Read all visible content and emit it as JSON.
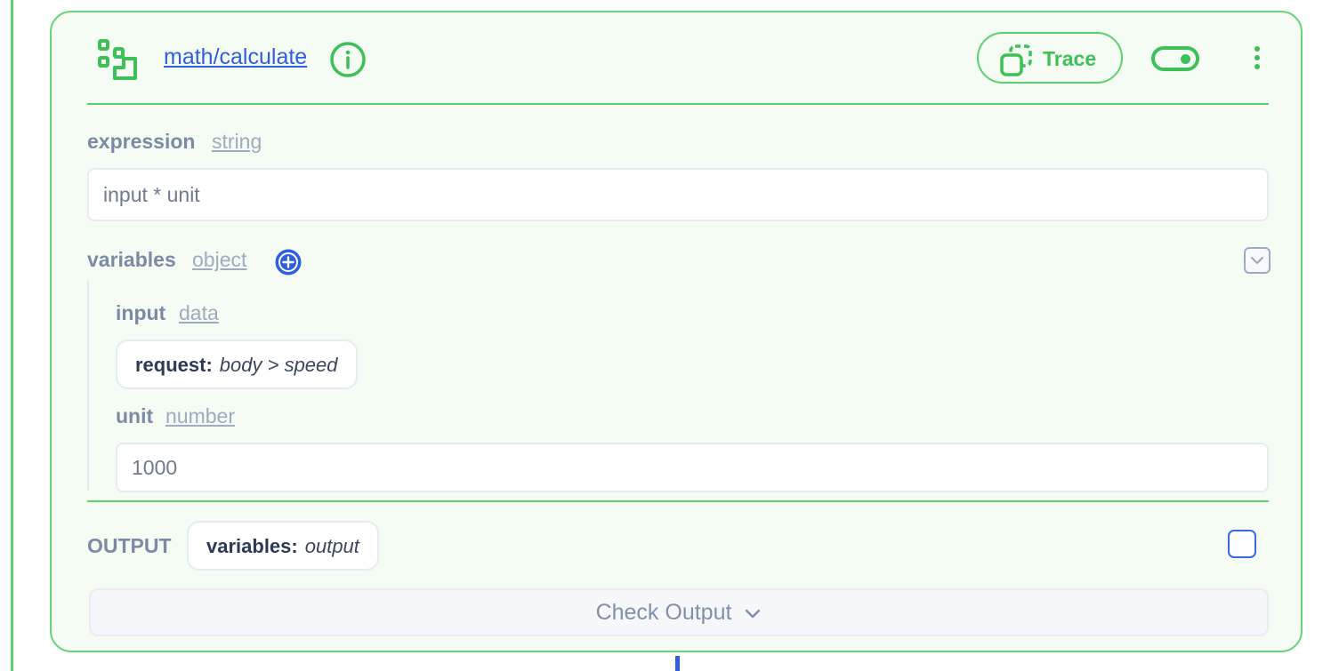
{
  "node": {
    "title": "math/calculate",
    "icon": "workflow-steps-icon",
    "info_icon": "info-circle-icon",
    "trace_label": "Trace",
    "trace_icon": "copy-dashed-icon",
    "enabled": true,
    "menu_icon": "vertical-dots-icon"
  },
  "fields": {
    "expression": {
      "label": "expression",
      "type": "string",
      "value": "input * unit"
    },
    "variables": {
      "label": "variables",
      "type": "object",
      "add_icon": "plus-circle-icon",
      "collapse_icon": "chevron-down-icon",
      "input": {
        "label": "input",
        "type": "data",
        "chip_key": "request:",
        "chip_value": "body > speed"
      },
      "unit": {
        "label": "unit",
        "type": "number",
        "value": "1000"
      }
    }
  },
  "output": {
    "label": "OUTPUT",
    "chip_key": "variables:",
    "chip_value": "output",
    "checked": false
  },
  "check_output": {
    "label": "Check Output"
  },
  "colors": {
    "accent_green": "#3fbf57",
    "border_green": "#6cd37d",
    "link_blue": "#2f5fe0",
    "muted_text": "#7c8aa6"
  }
}
